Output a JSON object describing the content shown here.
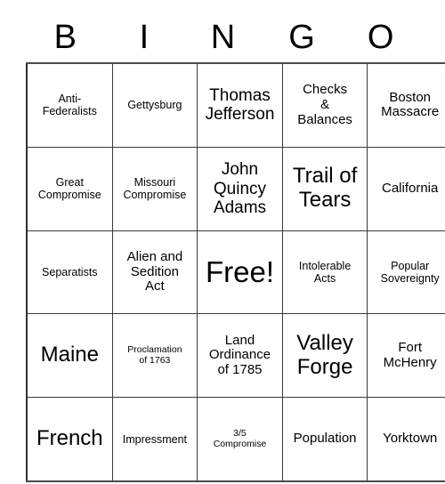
{
  "card": {
    "header_letters": [
      "B",
      "I",
      "N",
      "G",
      "O"
    ],
    "rows": [
      [
        {
          "text": "Anti-\nFederalists",
          "size": "sm"
        },
        {
          "text": "Gettysburg",
          "size": "sm"
        },
        {
          "text": "Thomas\nJefferson",
          "size": "lg"
        },
        {
          "text": "Checks\n&\nBalances",
          "size": "md"
        },
        {
          "text": "Boston\nMassacre",
          "size": "md"
        }
      ],
      [
        {
          "text": "Great\nCompromise",
          "size": "sm"
        },
        {
          "text": "Missouri\nCompromise",
          "size": "sm"
        },
        {
          "text": "John\nQuincy\nAdams",
          "size": "lg"
        },
        {
          "text": "Trail of\nTears",
          "size": "xl"
        },
        {
          "text": "California",
          "size": "md"
        }
      ],
      [
        {
          "text": "Separatists",
          "size": "sm"
        },
        {
          "text": "Alien and\nSedition\nAct",
          "size": "md"
        },
        {
          "text": "Free!",
          "size": "xxl"
        },
        {
          "text": "Intolerable\nActs",
          "size": "sm"
        },
        {
          "text": "Popular\nSovereignty",
          "size": "sm"
        }
      ],
      [
        {
          "text": "Maine",
          "size": "xl"
        },
        {
          "text": "Proclamation\nof 1763",
          "size": "xs"
        },
        {
          "text": "Land\nOrdinance\nof 1785",
          "size": "md"
        },
        {
          "text": "Valley\nForge",
          "size": "xl"
        },
        {
          "text": "Fort\nMcHenry",
          "size": "md"
        }
      ],
      [
        {
          "text": "French",
          "size": "xl"
        },
        {
          "text": "Impressment",
          "size": "sm"
        },
        {
          "text": "3/5\nCompromise",
          "size": "xs"
        },
        {
          "text": "Population",
          "size": "md"
        },
        {
          "text": "Yorktown",
          "size": "md"
        }
      ]
    ]
  }
}
